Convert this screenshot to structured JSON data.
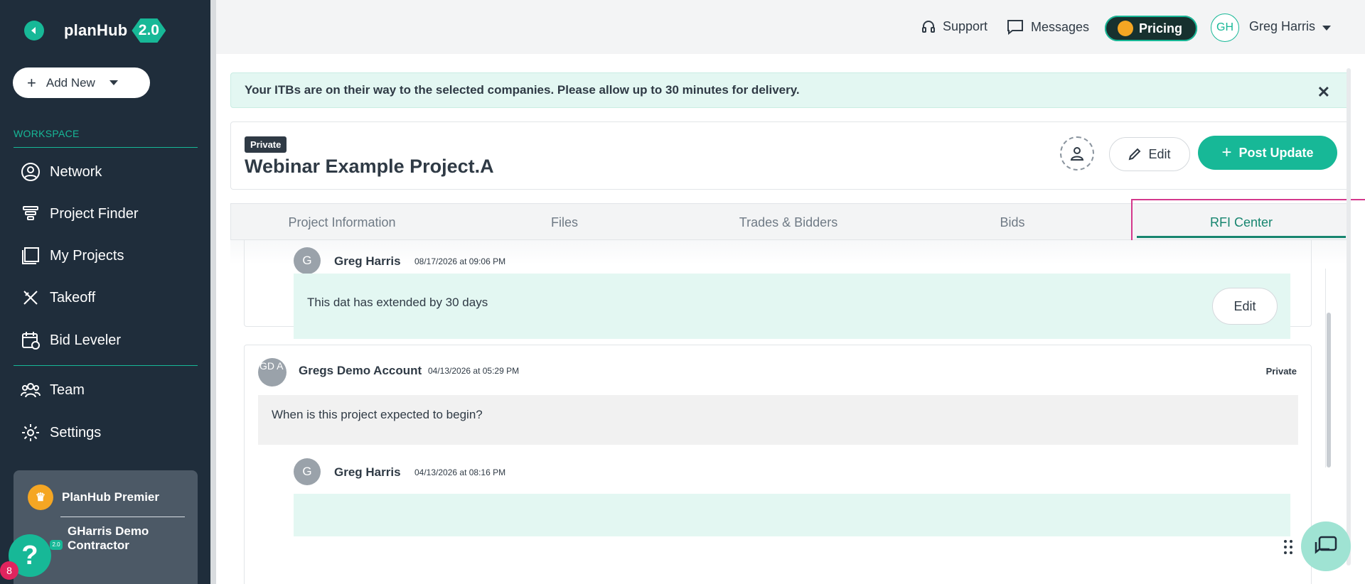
{
  "sidebar": {
    "logo_text": "planHub",
    "logo_version": "2.0",
    "add_new_label": "Add New",
    "workspace_label": "WORKSPACE",
    "items": [
      {
        "label": "Network",
        "icon": "user-circle-icon"
      },
      {
        "label": "Project Finder",
        "icon": "filter-icon"
      },
      {
        "label": "My Projects",
        "icon": "projects-icon"
      },
      {
        "label": "Takeoff",
        "icon": "ruler-pencil-icon"
      },
      {
        "label": "Bid Leveler",
        "icon": "calendar-icon"
      },
      {
        "label": "Team",
        "icon": "team-icon"
      },
      {
        "label": "Settings",
        "icon": "gear-icon"
      }
    ],
    "premier_label": "PlanHub Premier",
    "company_name": "GHarris Demo Contractor",
    "help_count": "8"
  },
  "topbar": {
    "support_label": "Support",
    "messages_label": "Messages",
    "pricing_label": "Pricing",
    "avatar_initials": "GH",
    "user_name": "Greg Harris"
  },
  "notice": {
    "text": "Your ITBs are on their way to the selected companies. Please allow up to 30 minutes for delivery.",
    "close": "✕"
  },
  "project": {
    "visibility_tag": "Private",
    "title": "Webinar Example Project.A",
    "edit_label": "Edit",
    "post_update_label": "Post Update"
  },
  "tabs": [
    {
      "label": "Project Information"
    },
    {
      "label": "Files"
    },
    {
      "label": "Trades & Bidders"
    },
    {
      "label": "Bids"
    },
    {
      "label": "RFI Center",
      "active": true
    }
  ],
  "thread": {
    "reply1": {
      "avatar": "G",
      "author": "Greg Harris",
      "time": "08/17/2026 at 09:06 PM",
      "text": "This dat has extended by 30 days",
      "edit_label": "Edit"
    },
    "question": {
      "avatar": "GD A",
      "author": "Gregs Demo Account",
      "time": "04/13/2026 at 05:29 PM",
      "visibility": "Private",
      "text": "When is this project expected to begin?"
    },
    "reply2": {
      "avatar": "G",
      "author": "Greg Harris",
      "time": "04/13/2026 at 08:16 PM"
    }
  },
  "colors": {
    "accent": "#17b897",
    "sidebar_bg": "#1f2d3b",
    "highlight": "#d4388c"
  }
}
